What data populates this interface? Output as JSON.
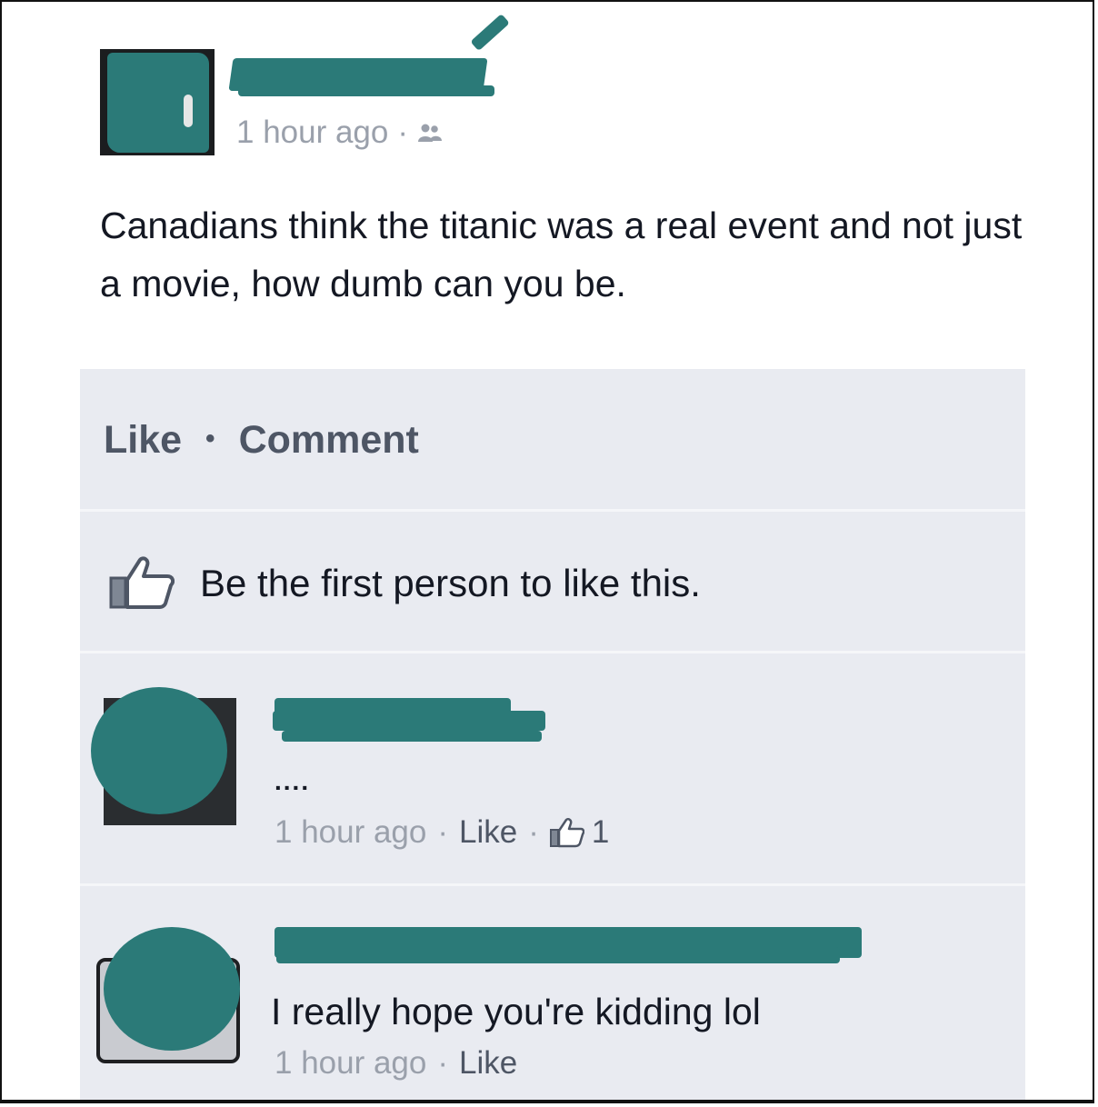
{
  "post": {
    "timestamp": "1 hour ago",
    "separator": "·",
    "audience_icon": "friends-icon",
    "text": "Canadians think the titanic was a real event and not just a movie, how dumb can you be."
  },
  "actions": {
    "like_label": "Like",
    "separator": "•",
    "comment_label": "Comment"
  },
  "likes": {
    "text": "Be the first person to like this."
  },
  "comments": [
    {
      "text": "....",
      "timestamp": "1 hour ago",
      "like_label": "Like",
      "separator": "·",
      "like_count": "1"
    },
    {
      "text": "I really hope you're kidding lol",
      "timestamp": "1 hour ago",
      "like_label": "Like",
      "separator": "·"
    }
  ],
  "colors": {
    "redaction": "#2b7a78",
    "feedback_bg": "#e9ebf1",
    "meta_text": "#9aa0ab",
    "link_text": "#4e5665"
  }
}
